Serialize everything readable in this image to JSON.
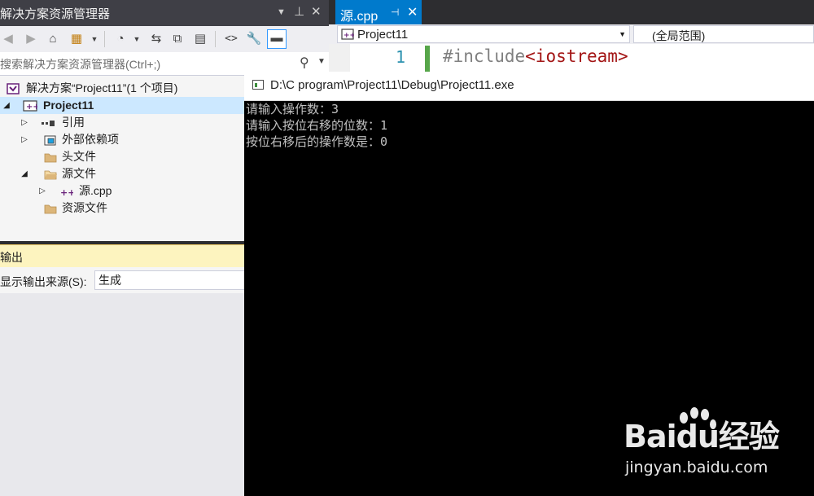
{
  "solution_explorer": {
    "title": "解决方案资源管理器",
    "search_placeholder": "搜索解决方案资源管理器(Ctrl+;)",
    "tree": [
      {
        "label": "解决方案“Project11”(1 个项目)"
      },
      {
        "label": "Project11"
      },
      {
        "label": "引用"
      },
      {
        "label": "外部依赖项"
      },
      {
        "label": "头文件"
      },
      {
        "label": "源文件"
      },
      {
        "label": "源.cpp"
      },
      {
        "label": "资源文件"
      }
    ]
  },
  "output": {
    "title": "输出",
    "source_label": "显示输出来源(S):",
    "source_value": "生成"
  },
  "editor": {
    "tab_name": "源.cpp",
    "project_combo": "Project11",
    "scope_combo": "(全局范围)",
    "line_number": "1",
    "code_directive": "#include",
    "code_header": "<iostream>"
  },
  "console": {
    "title": "D:\\C program\\Project11\\Debug\\Project11.exe",
    "lines": [
      "请输入操作数：3",
      "请输入按位右移的位数：1",
      "按位右移后的操作数是：0"
    ]
  },
  "watermark": {
    "brand": "Baidu经验",
    "url": "jingyan.baidu.com"
  },
  "colors": {
    "accent": "#007acc",
    "selected_row": "#cce8ff",
    "output_header": "#fdf4bf",
    "console_bg": "#000000",
    "console_text": "#c0c0c0"
  }
}
